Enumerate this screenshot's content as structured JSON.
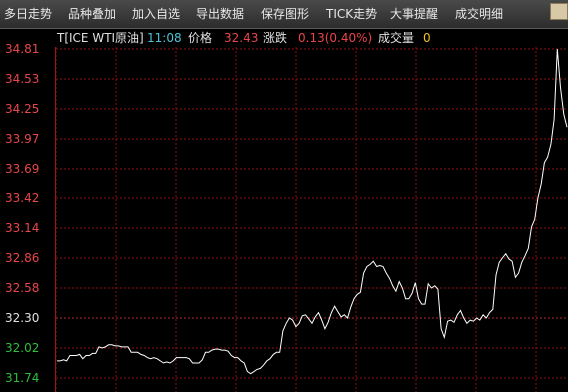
{
  "toolbar": {
    "items": [
      "多日走势",
      "品种叠加",
      "加入自选",
      "导出数据",
      "保存图形",
      "TICK走势",
      "大事提醒",
      "成交明细"
    ]
  },
  "quote": {
    "symbol": "T[ICE WTI原油]",
    "time": "11:08",
    "price_label": "价格",
    "price": "32.43",
    "change_label": "涨跌",
    "change": "0.13(0.40%)",
    "volume_label": "成交量",
    "volume": "0"
  },
  "colors": {
    "up_red": "#e8464a",
    "volume_yellow": "#f0c21a",
    "time_cyan": "#4fc3d6",
    "axis_green": "#2fbf3b",
    "grid_red": "#8b1010",
    "line_white": "#ffffff"
  },
  "chart_data": {
    "type": "line",
    "yticks_red": [
      "34.81",
      "34.53",
      "34.25",
      "33.97",
      "33.69",
      "33.42",
      "33.14",
      "32.86",
      "32.58"
    ],
    "yticks_white": [
      "32.30"
    ],
    "yticks_green": [
      "32.02",
      "31.74"
    ],
    "ylim": [
      31.74,
      34.81
    ],
    "series": [
      {
        "values": [
          31.9,
          31.9,
          31.91,
          31.9,
          31.95,
          31.95,
          31.95,
          31.96,
          31.92,
          31.95,
          31.95,
          31.97,
          31.97,
          32.03,
          32.02,
          32.03,
          32.05,
          32.05,
          32.04,
          32.04,
          32.03,
          32.03,
          32.03,
          31.98,
          31.98,
          31.98,
          31.96,
          31.95,
          31.93,
          31.92,
          31.93,
          31.92,
          31.9,
          31.88,
          31.89,
          31.88,
          31.9,
          31.93,
          31.93,
          31.93,
          31.93,
          31.92,
          31.88,
          31.88,
          31.88,
          31.91,
          31.98,
          31.98,
          32.0,
          32.01,
          32.01,
          32.0,
          32.0,
          31.99,
          31.95,
          31.93,
          31.93,
          31.9,
          31.88,
          31.8,
          31.78,
          31.8,
          31.82,
          31.83,
          31.86,
          31.9,
          31.92,
          31.96,
          31.98,
          31.98,
          32.18,
          32.25,
          32.3,
          32.28,
          32.22,
          32.25,
          32.32,
          32.33,
          32.29,
          32.25,
          32.31,
          32.35,
          32.28,
          32.2,
          32.26,
          32.35,
          32.41,
          32.36,
          32.31,
          32.33,
          32.3,
          32.4,
          32.48,
          32.52,
          32.54,
          32.72,
          32.78,
          32.8,
          32.83,
          32.78,
          32.79,
          32.78,
          32.72,
          32.67,
          32.6,
          32.55,
          32.64,
          32.58,
          32.48,
          32.48,
          32.53,
          32.63,
          32.48,
          32.43,
          32.43,
          32.62,
          32.58,
          32.6,
          32.57,
          32.2,
          32.12,
          32.27,
          32.28,
          32.26,
          32.33,
          32.37,
          32.3,
          32.25,
          32.28,
          32.27,
          32.3,
          32.28,
          32.33,
          32.3,
          32.35,
          32.38,
          32.7,
          32.82,
          32.86,
          32.9,
          32.85,
          32.83,
          32.68,
          32.72,
          32.82,
          32.88,
          32.95,
          33.15,
          33.22,
          33.42,
          33.55,
          33.75,
          33.8,
          33.92,
          34.15,
          34.81,
          34.45,
          34.2,
          34.08
        ]
      }
    ]
  }
}
